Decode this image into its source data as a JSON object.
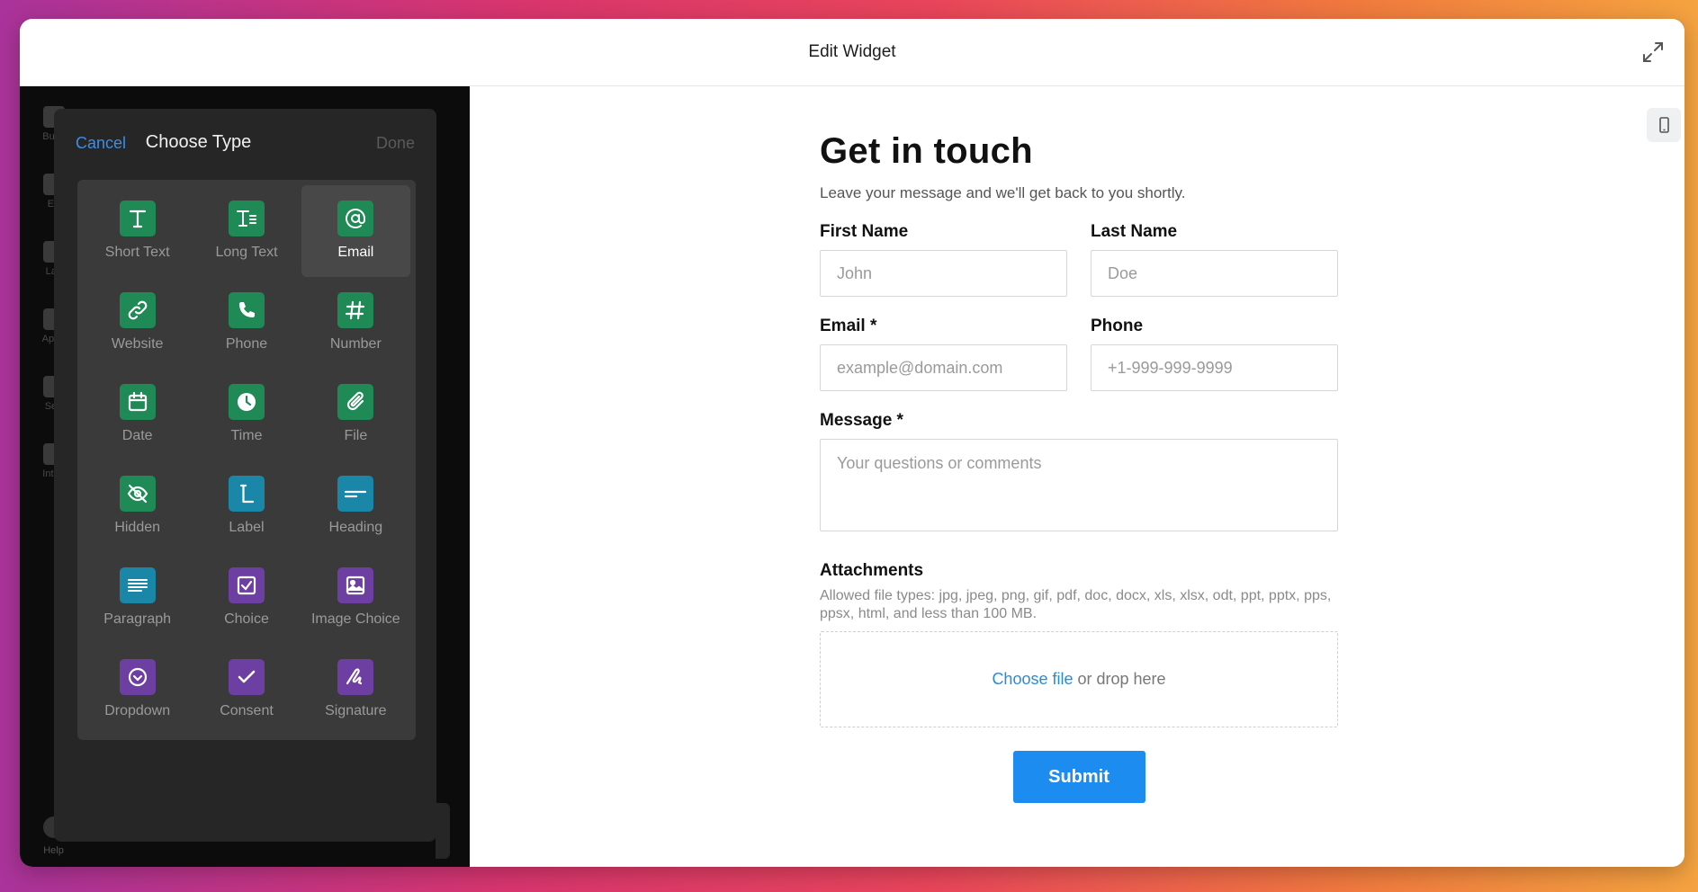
{
  "window": {
    "title": "Edit Widget"
  },
  "rail": {
    "items": [
      "Build",
      "En",
      "Lay",
      "Appe",
      "Sett",
      "Integ"
    ],
    "help": "Help"
  },
  "panel": {
    "cancel": "Cancel",
    "title": "Choose Type",
    "done": "Done",
    "types": [
      {
        "label": "Short Text",
        "icon": "short-text-icon",
        "color": "#1f8a55"
      },
      {
        "label": "Long Text",
        "icon": "long-text-icon",
        "color": "#1f8a55"
      },
      {
        "label": "Email",
        "icon": "at-sign-icon",
        "color": "#1f8a55",
        "selected": true
      },
      {
        "label": "Website",
        "icon": "link-icon",
        "color": "#1f8a55"
      },
      {
        "label": "Phone",
        "icon": "phone-icon",
        "color": "#1f8a55"
      },
      {
        "label": "Number",
        "icon": "hash-icon",
        "color": "#1f8a55"
      },
      {
        "label": "Date",
        "icon": "calendar-icon",
        "color": "#1f8a55"
      },
      {
        "label": "Time",
        "icon": "clock-icon",
        "color": "#1f8a55"
      },
      {
        "label": "File",
        "icon": "paperclip-icon",
        "color": "#1f8a55"
      },
      {
        "label": "Hidden",
        "icon": "eye-off-icon",
        "color": "#1f8a55"
      },
      {
        "label": "Label",
        "icon": "label-icon",
        "color": "#1a86a8"
      },
      {
        "label": "Heading",
        "icon": "heading-icon",
        "color": "#1a86a8"
      },
      {
        "label": "Paragraph",
        "icon": "paragraph-icon",
        "color": "#1a86a8"
      },
      {
        "label": "Choice",
        "icon": "checkbox-icon",
        "color": "#6e3fa3"
      },
      {
        "label": "Image Choice",
        "icon": "image-icon",
        "color": "#6e3fa3"
      },
      {
        "label": "Dropdown",
        "icon": "chevron-circle-icon",
        "color": "#6e3fa3"
      },
      {
        "label": "Consent",
        "icon": "check-icon",
        "color": "#6e3fa3"
      },
      {
        "label": "Signature",
        "icon": "signature-icon",
        "color": "#6e3fa3"
      }
    ]
  },
  "form": {
    "title": "Get in touch",
    "subtitle": "Leave your message and we'll get back to you shortly.",
    "first_name": {
      "label": "First Name",
      "placeholder": "John"
    },
    "last_name": {
      "label": "Last Name",
      "placeholder": "Doe"
    },
    "email": {
      "label": "Email *",
      "placeholder": "example@domain.com"
    },
    "phone": {
      "label": "Phone",
      "placeholder": "+1-999-999-9999"
    },
    "message": {
      "label": "Message *",
      "placeholder": "Your questions or comments"
    },
    "attachments": {
      "label": "Attachments",
      "hint": "Allowed file types: jpg, jpeg, png, gif, pdf, doc, docx, xls, xlsx, odt, ppt, pptx, pps, ppsx, html, and less than 100 MB.",
      "choose": "Choose file",
      "drop": " or drop here"
    },
    "submit": "Submit"
  },
  "colors": {
    "accent": "#1c8cf0",
    "green": "#1f8a55",
    "teal": "#1a86a8",
    "purple": "#6e3fa3"
  }
}
